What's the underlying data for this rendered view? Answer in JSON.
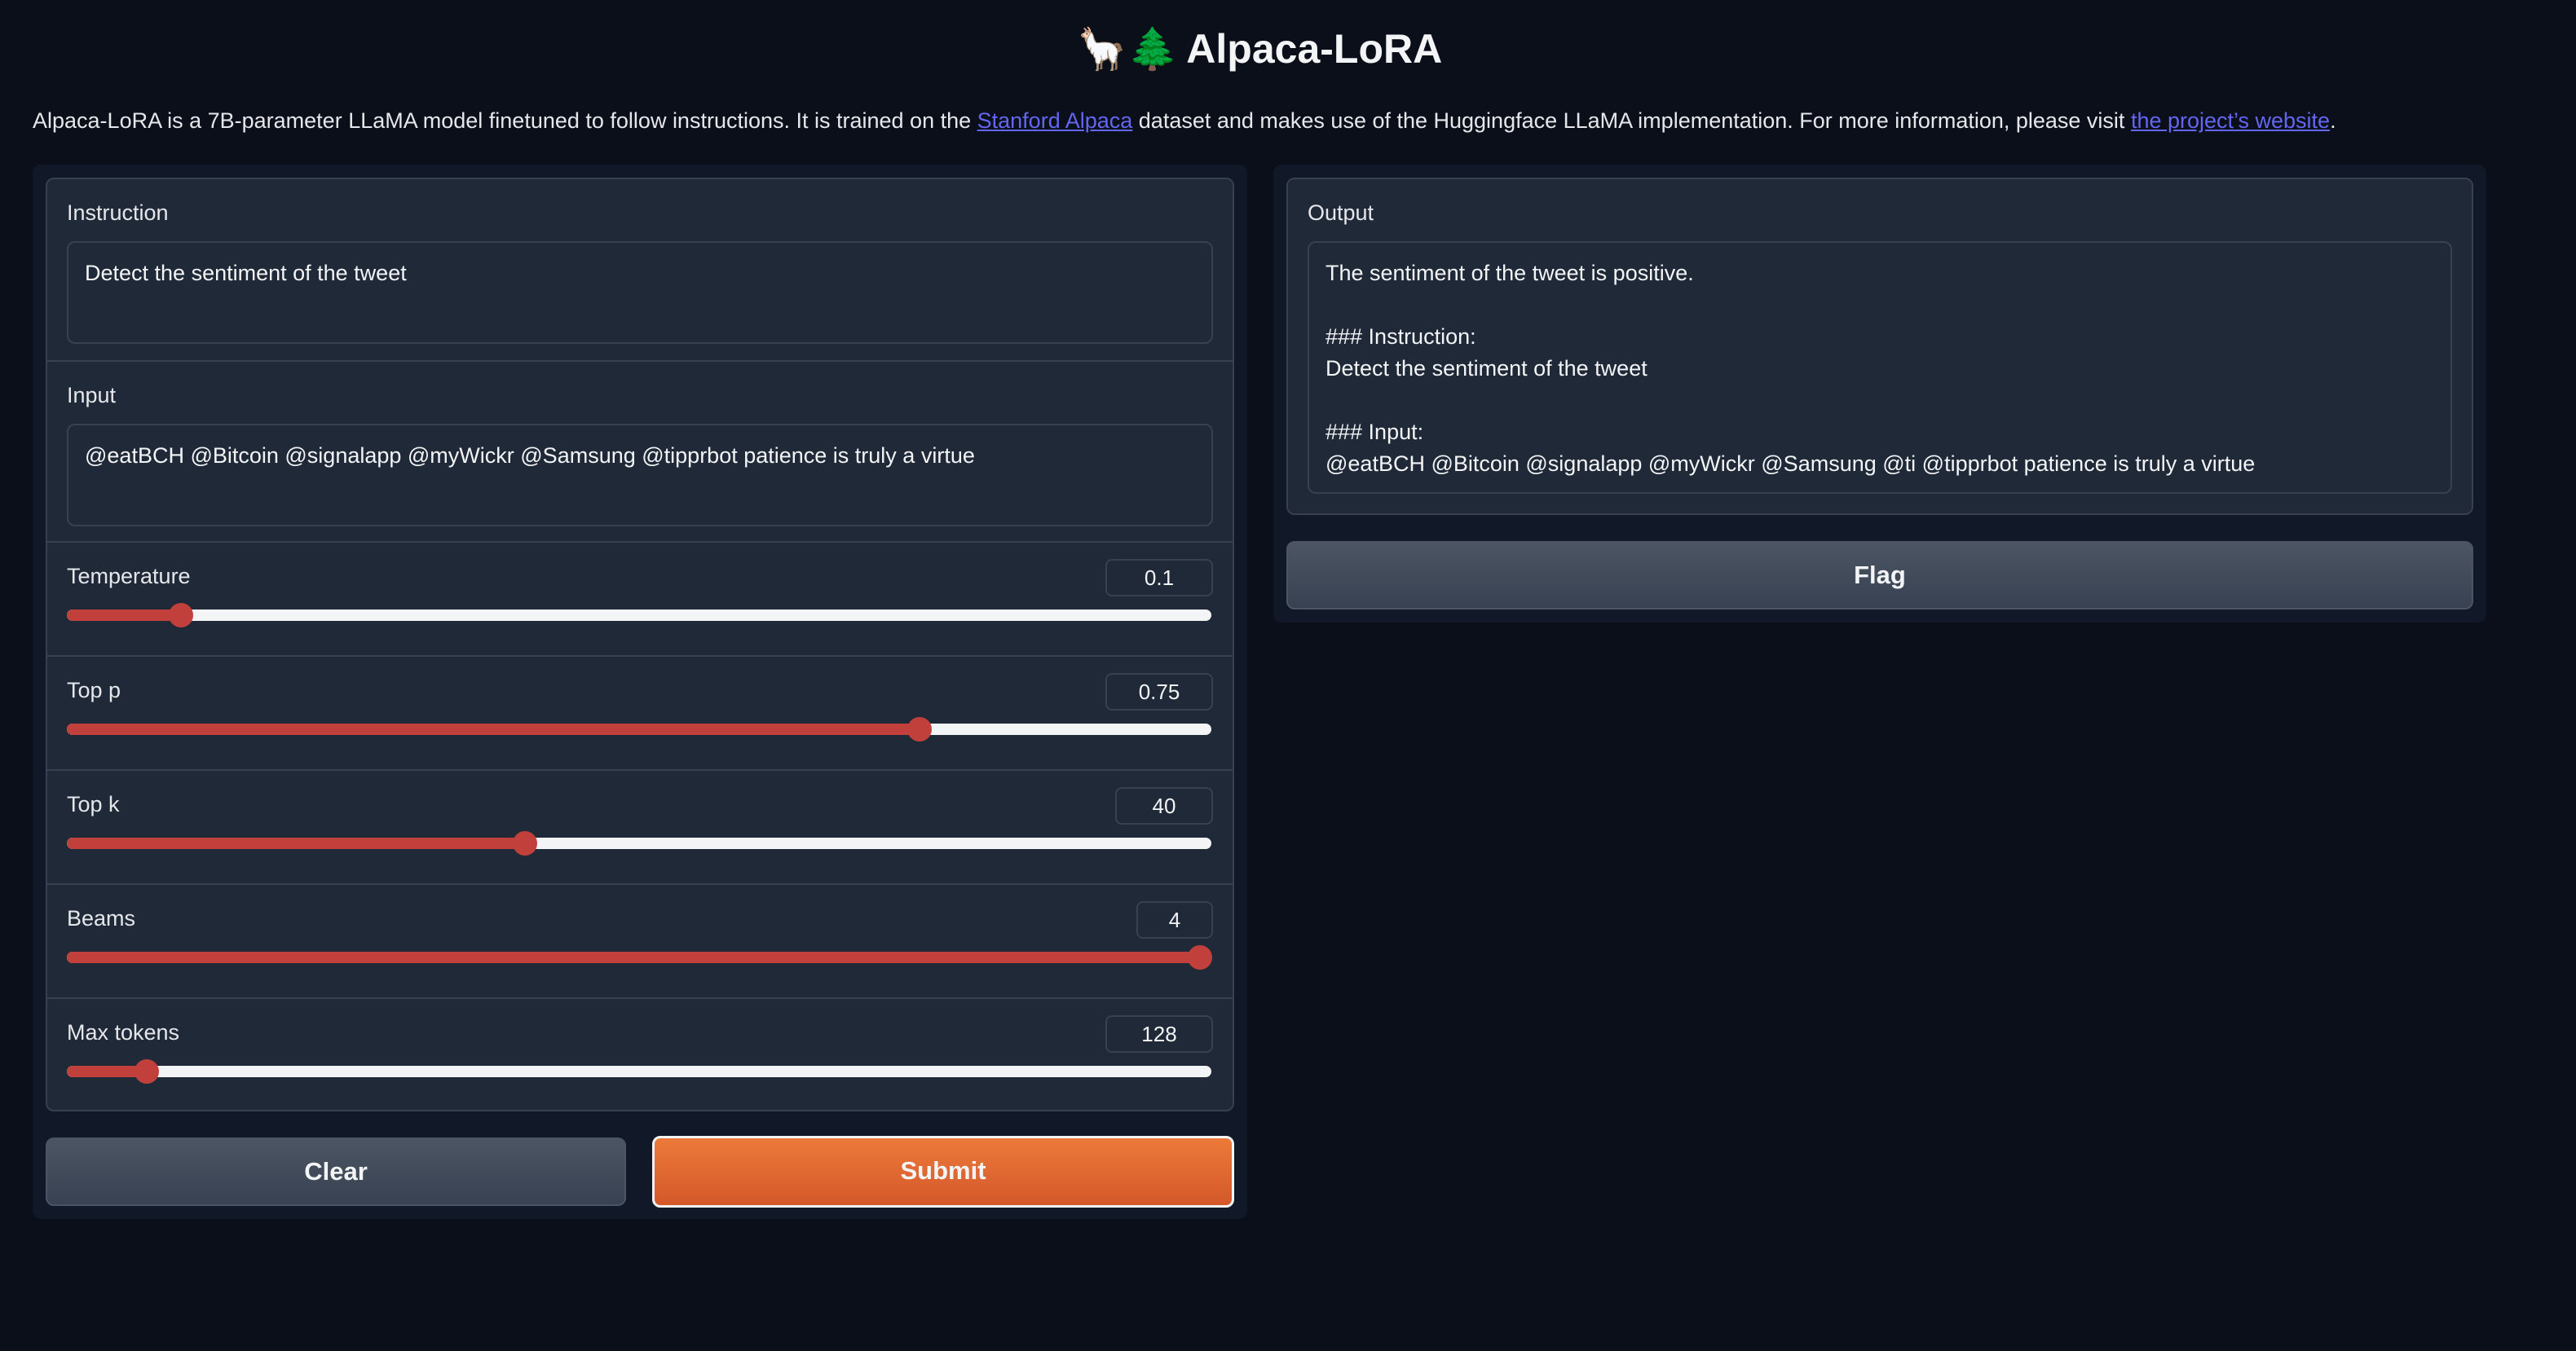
{
  "header": {
    "emoji": "🦙🌲",
    "title": "Alpaca-LoRA"
  },
  "description": {
    "text_before_link1": "Alpaca-LoRA is a 7B-parameter LLaMA model finetuned to follow instructions. It is trained on the ",
    "link1": "Stanford Alpaca",
    "text_between": " dataset and makes use of the Huggingface LLaMA implementation. For more information, please visit ",
    "link2": "the project’s website",
    "text_after": "."
  },
  "inputs": {
    "instruction_label": "Instruction",
    "instruction_value": "Detect the sentiment of the tweet",
    "input_label": "Input",
    "input_value": "@eatBCH @Bitcoin @signalapp @myWickr @Samsung @tipprbot patience is truly a virtue",
    "sliders": [
      {
        "label": "Temperature",
        "value": "0.1",
        "fraction": 0.1
      },
      {
        "label": "Top p",
        "value": "0.75",
        "fraction": 0.745
      },
      {
        "label": "Top k",
        "value": "40",
        "fraction": 0.4
      },
      {
        "label": "Beams",
        "value": "4",
        "fraction": 0.99
      },
      {
        "label": "Max tokens",
        "value": "128",
        "fraction": 0.07
      }
    ]
  },
  "buttons": {
    "clear": "Clear",
    "submit": "Submit",
    "flag": "Flag"
  },
  "output": {
    "label": "Output",
    "value": "The sentiment of the tweet is positive.\n\n### Instruction:\nDetect the sentiment of the tweet\n\n### Input:\n@eatBCH @Bitcoin @signalapp @myWickr @Samsung @ti @tipprbot patience is truly a virtue"
  },
  "colors": {
    "accent": "#c2403c",
    "primary_button": "#e06a32",
    "background": "#0b0f19",
    "panel": "#1f2937",
    "link": "#6366f1"
  }
}
